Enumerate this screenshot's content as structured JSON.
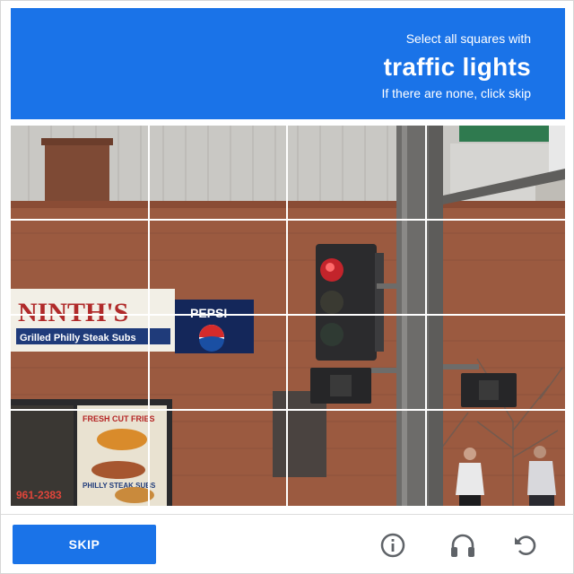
{
  "header": {
    "subtitle": "Select all squares with",
    "title": "traffic lights",
    "instruction": "If there are none, click skip"
  },
  "scene": {
    "store_sign": "NINTH'S",
    "store_tagline": "Grilled Philly Steak Subs",
    "pepsi_label": "PEPSI",
    "window_fries": "FRESH CUT FRIES",
    "window_steak": "PHILLY STEAK SUBS",
    "window_phone": "961-2383"
  },
  "footer": {
    "skip_label": "SKIP"
  },
  "colors": {
    "accent": "#1a73e8",
    "icon": "#5f6368"
  },
  "icons": [
    "reload-icon",
    "headphones-icon",
    "info-icon"
  ]
}
